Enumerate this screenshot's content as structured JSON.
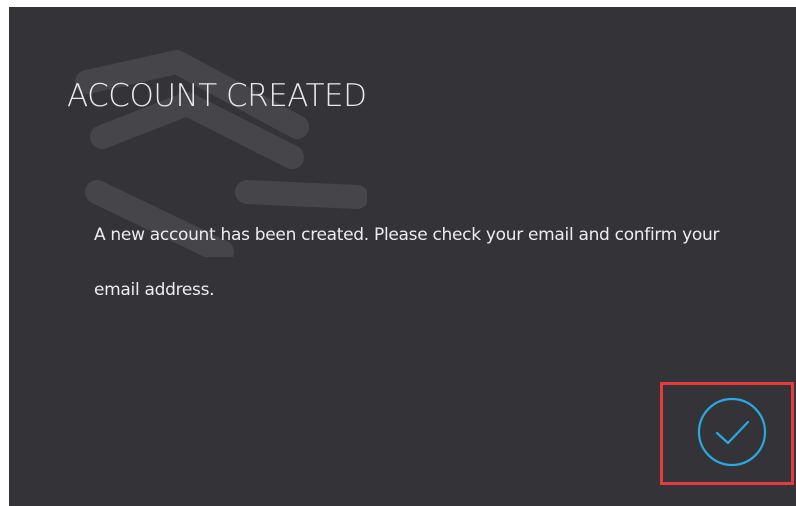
{
  "dialog": {
    "title": "ACCOUNT CREATED",
    "message": "A new account has been created. Please check your email and confirm your email address.",
    "confirm_icon": "checkmark-circle-icon",
    "watermark_icon": "logo-s-watermark-icon"
  },
  "colors": {
    "background": "#333338",
    "text": "#e9e9ea",
    "accent": "#2aa8e0",
    "highlight": "#e53b3d"
  }
}
